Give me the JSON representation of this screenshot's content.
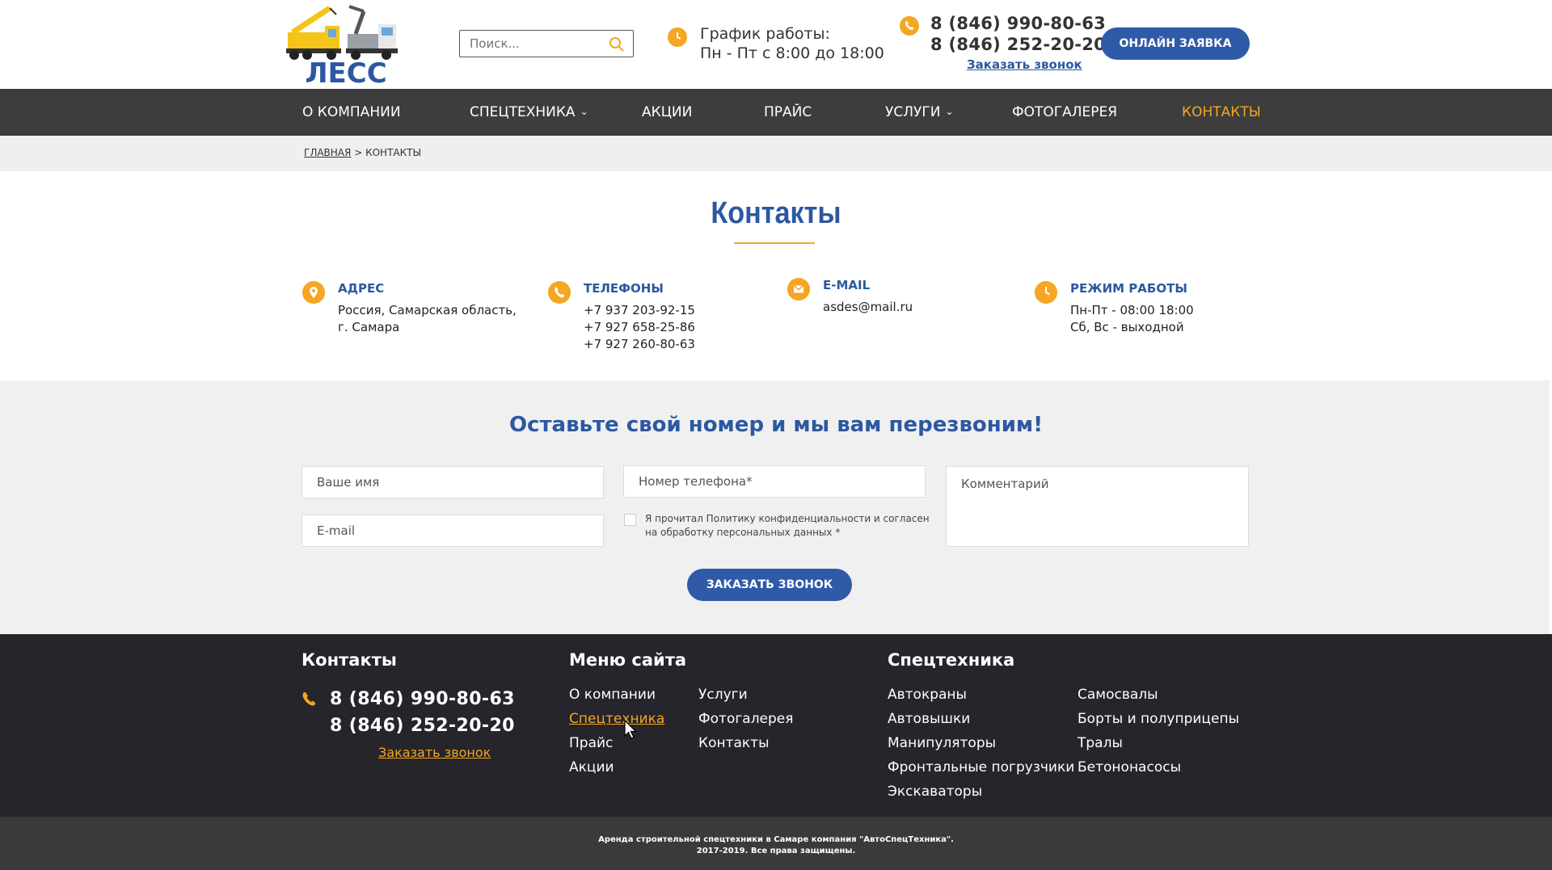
{
  "header": {
    "logo_text": "ЛЕСС",
    "search_placeholder": "Поиск...",
    "schedule_title": "График работы:",
    "schedule_hours": "Пн - Пт с 8:00 до 18:00",
    "phone1": "8 (846) 990-80-63",
    "phone2": "8 (846) 252-20-20",
    "callback_link": "Заказать звонок",
    "online_button": "ОНЛАЙН ЗАЯВКА"
  },
  "nav": {
    "items": [
      {
        "label": "О КОМПАНИИ"
      },
      {
        "label": "СПЕЦТЕХНИКА"
      },
      {
        "label": "АКЦИИ"
      },
      {
        "label": "ПРАЙС"
      },
      {
        "label": "УСЛУГИ"
      },
      {
        "label": "ФОТОГАЛЕРЕЯ"
      },
      {
        "label": "КОНТАКТЫ"
      }
    ],
    "active": "КОНТАКТЫ"
  },
  "breadcrumb": {
    "home": "ГЛАВНАЯ",
    "separator": ">",
    "current": "КОНТАКТЫ"
  },
  "contacts": {
    "title": "Контакты",
    "address": {
      "heading": "АДРЕС",
      "line1": "Россия, Самарская область,",
      "line2": "г. Самара"
    },
    "phones": {
      "heading": "ТЕЛЕФОНЫ",
      "list": [
        "+7 937 203-92-15",
        "+7 927 658-25-86",
        "+7 927 260-80-63"
      ]
    },
    "email": {
      "heading": "E-MAIL",
      "value": "asdes@mail.ru"
    },
    "hours": {
      "heading": "РЕЖИМ РАБОТЫ",
      "line1": "Пн-Пт - 08:00 18:00",
      "line2": "Сб, Вс - выходной"
    }
  },
  "callback_form": {
    "title": "Оставьте свой номер и мы вам перезвоним!",
    "name_placeholder": "Ваше имя",
    "email_placeholder": "E-mail",
    "phone_placeholder": "Номер телефона*",
    "comment_placeholder": "Комментарий",
    "consent_text": "Я прочитал Политику конфиденциальности и согласен на обработку персональных данных *",
    "submit_label": "ЗАКАЗАТЬ ЗВОНОК"
  },
  "footer": {
    "contacts_heading": "Контакты",
    "phone1": "8 (846) 990-80-63",
    "phone2": "8 (846) 252-20-20",
    "callback_link": "Заказать звонок",
    "menu_heading": "Меню сайта",
    "menu_col1": [
      "О компании",
      "Спецтехника",
      "Прайс",
      "Акции"
    ],
    "menu_col2": [
      "Услуги",
      "Фотогалерея",
      "Контакты"
    ],
    "equipment_heading": "Спецтехника",
    "equipment_col1": [
      "Автокраны",
      "Автовышки",
      "Манипуляторы",
      "Фронтальные погрузчики",
      "Экскаваторы"
    ],
    "equipment_col2": [
      "Самосвалы",
      "Борты и полуприцепы",
      "Тралы",
      "Бетононасосы"
    ],
    "copyright_line1": "Аренда строительной спецтехники в Самаре компания \"АвтоСпецТехника\".",
    "copyright_line2": "2017-2019. Все права защищены."
  },
  "colors": {
    "brand_blue": "#2c58a0",
    "accent_orange": "#f5a623",
    "nav_bg": "#3d3d3d",
    "footer_bg": "#25252b"
  },
  "icons": [
    "search-icon",
    "clock-icon",
    "phone-icon",
    "location-icon",
    "mail-icon",
    "chevron-down-icon",
    "cursor-icon"
  ]
}
